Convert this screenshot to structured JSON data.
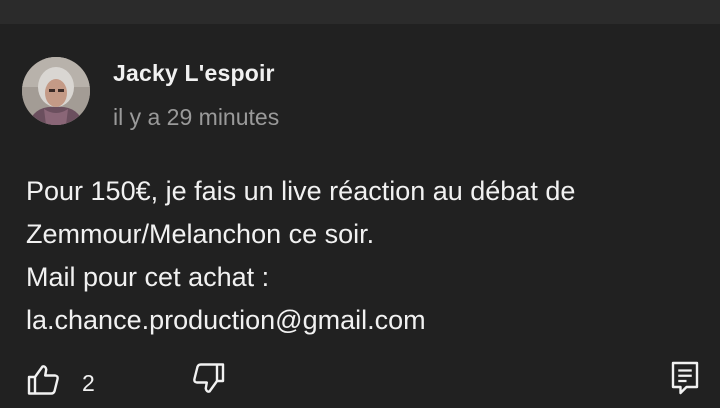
{
  "comment": {
    "author": "Jacky L'espoir",
    "timestamp": "il y a 29 minutes",
    "body_lines": [
      "Pour 150€, je fais un live réaction au débat de",
      "Zemmour/Melanchon ce soir.",
      "Mail pour cet achat :",
      "la.chance.production@gmail.com"
    ],
    "like_count": "2"
  },
  "icons": {
    "like": "thumbs-up-icon",
    "dislike": "thumbs-down-icon",
    "reply": "comment-reply-icon"
  },
  "colors": {
    "background": "#212121",
    "text": "#f1f1f1",
    "secondary_text": "#9a9a9a"
  }
}
